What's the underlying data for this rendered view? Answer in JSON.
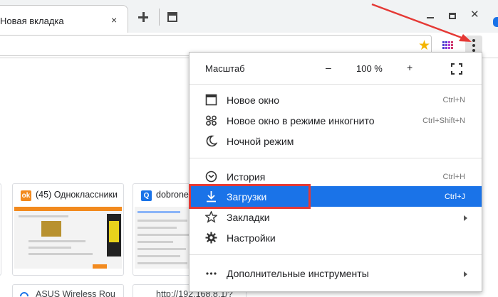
{
  "tab": {
    "title": "Новая вкладка",
    "close_glyph": "×"
  },
  "window": {
    "close_glyph": "✕"
  },
  "toolbar": {
    "star_glyph": "★"
  },
  "colors": {
    "accent": "#1a73e8",
    "highlight": "#e53935",
    "odnoklassniki": "#f28a1e"
  },
  "tiles": [
    {
      "title": "(45) Одноклассники",
      "favicon": "ok-icon",
      "favicon_glyph": "ok"
    },
    {
      "title": "dobrone",
      "favicon": "search-icon",
      "favicon_glyph": "Q"
    }
  ],
  "tiles_bottom": [
    {
      "title": "ASUS Wireless Rou"
    },
    {
      "title": "http://192.168.8.1/?"
    }
  ],
  "menu": {
    "zoom_label": "Масштаб",
    "zoom_minus": "–",
    "zoom_value": "100 %",
    "zoom_plus": "+",
    "items": [
      {
        "label": "Новое окно",
        "shortcut": "Ctrl+N",
        "icon": "new-window-icon"
      },
      {
        "label": "Новое окно в режиме инкогнито",
        "shortcut": "Ctrl+Shift+N",
        "icon": "incognito-icon"
      },
      {
        "label": "Ночной режим",
        "shortcut": "",
        "icon": "moon-icon"
      },
      {
        "label": "История",
        "shortcut": "Ctrl+H",
        "icon": "history-icon"
      },
      {
        "label": "Загрузки",
        "shortcut": "Ctrl+J",
        "icon": "download-icon",
        "active": true
      },
      {
        "label": "Закладки",
        "shortcut": "",
        "icon": "bookmark-star-icon",
        "submenu": true
      },
      {
        "label": "Настройки",
        "shortcut": "",
        "icon": "settings-gear-icon"
      },
      {
        "label": "Дополнительные инструменты",
        "shortcut": "",
        "icon": "more-tools-icon",
        "submenu": true
      }
    ]
  }
}
